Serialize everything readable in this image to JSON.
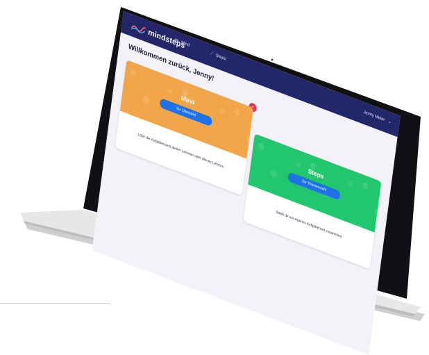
{
  "app": {
    "brand": "mindsteps",
    "nav": [
      {
        "label": "Mind",
        "icon": "book-icon"
      },
      {
        "label": "Steps",
        "icon": "chart-icon"
      }
    ],
    "user_name": "Jenny Meier"
  },
  "main": {
    "welcome": "Willkommen zurück, Jenny!",
    "cards": [
      {
        "title": "Mind",
        "button": "Zur Übersicht",
        "description": "Löse die Aufgabensets deiner Lehrerin oder deines Lehrers.",
        "color": "#f0a548"
      },
      {
        "title": "Steps",
        "button": "Zur Themenwahl",
        "description": "Stelle dir ein eigenes Aufgabenset zusammen.",
        "color": "#22c66c"
      }
    ]
  },
  "colors": {
    "topbar": "#24266a",
    "accent": "#1f72e6",
    "badge": "#e23a55"
  }
}
